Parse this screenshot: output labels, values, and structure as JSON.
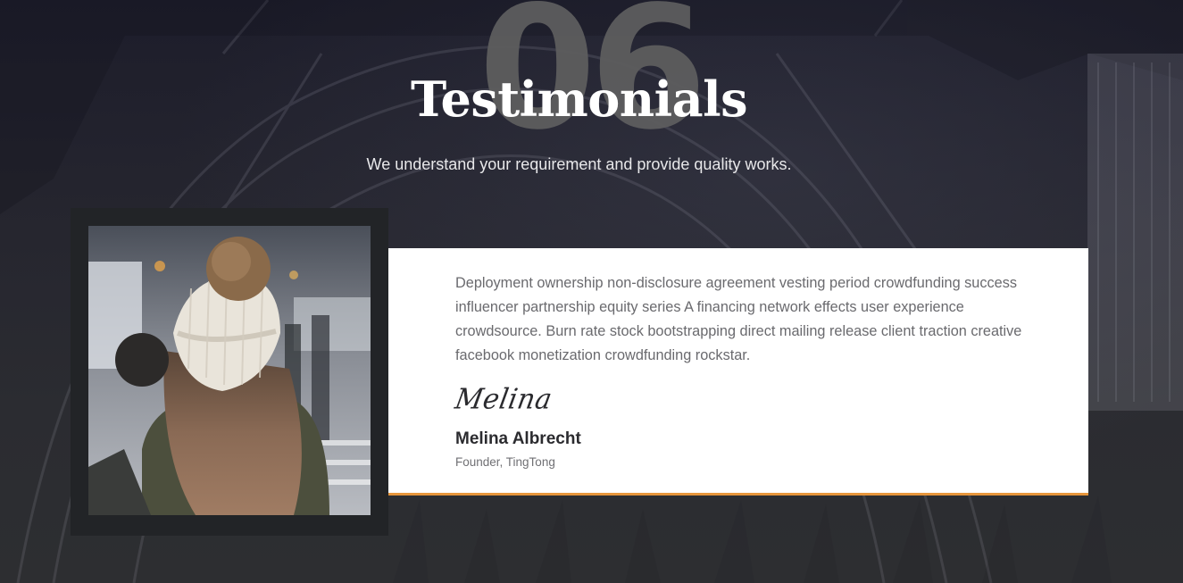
{
  "section": {
    "number": "06",
    "title": "Testimonials",
    "subtitle": "We understand your requirement and provide quality works."
  },
  "testimonial": {
    "quote": "Deployment ownership non-disclosure agreement vesting period crowdfunding success influencer partnership equity series A financing network effects user experience crowdsource. Burn rate stock bootstrapping direct mailing release client traction creative facebook monetization crowdfunding rockstar.",
    "signature": "Melina",
    "name": "Melina Albrecht",
    "role": "Founder, TingTong",
    "photo_icon": "person-photo-icon"
  },
  "colors": {
    "background": "#25252f",
    "card_background": "#ffffff",
    "accent": "#e6953b",
    "frame": "#222427",
    "big_number": "#5d5d5e"
  }
}
